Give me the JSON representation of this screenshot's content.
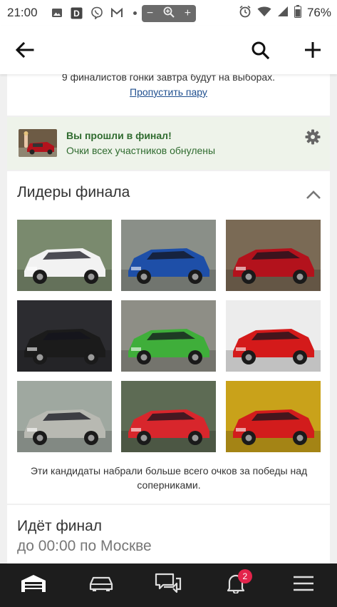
{
  "status_bar": {
    "time": "21:00",
    "battery": "76%",
    "icons": [
      "image-icon",
      "d-app-icon",
      "viber-icon",
      "gmail-icon",
      "alarm-icon",
      "wifi-icon",
      "signal-icon",
      "battery-icon"
    ]
  },
  "zoom_control": {
    "minus": "−",
    "plus": "+"
  },
  "app_bar": {
    "icons": [
      "back-arrow-icon",
      "search-icon",
      "add-icon"
    ]
  },
  "top_card": {
    "cut_text": "9 финалистов гонки завтра будут на выборах.",
    "skip_link": "Пропустить пару"
  },
  "finalist_notice": {
    "title": "Вы прошли в финал!",
    "subtitle": "Очки всех участников обнулены"
  },
  "leaders": {
    "title": "Лидеры финала",
    "photos": [
      {
        "name": "white-sports-coupe",
        "color": "#f2f2f2",
        "bg": "#7a8a6e"
      },
      {
        "name": "blue-rally-sedan",
        "color": "#1e4fa8",
        "bg": "#8a8f88"
      },
      {
        "name": "red-hatchback-with-girl",
        "color": "#b3121c",
        "bg": "#7a6a55"
      },
      {
        "name": "black-sedan-night",
        "color": "#1b1b1b",
        "bg": "#2c2c30"
      },
      {
        "name": "green-microcar",
        "color": "#3fae3a",
        "bg": "#8e8e86"
      },
      {
        "name": "red-audi-front",
        "color": "#d41a1a",
        "bg": "#ececec"
      },
      {
        "name": "grey-lada-sedan",
        "color": "#b8b9b2",
        "bg": "#9fa8a0"
      },
      {
        "name": "red-coupe-rear",
        "color": "#d8262c",
        "bg": "#5d6b54"
      },
      {
        "name": "red-sedan-garage",
        "color": "#d21c1c",
        "bg": "#c9a21a"
      }
    ],
    "caption": "Эти кандидаты набрали больше всего очков за победы над соперниками."
  },
  "final_status": {
    "title": "Идёт финал",
    "subtitle": "до 00:00 по Москве"
  },
  "bottom_nav": {
    "items": [
      "garage-icon",
      "car-icon",
      "chat-icon",
      "bell-icon",
      "menu-icon"
    ],
    "notification_count": "2",
    "badge_color": "#e3244b"
  }
}
